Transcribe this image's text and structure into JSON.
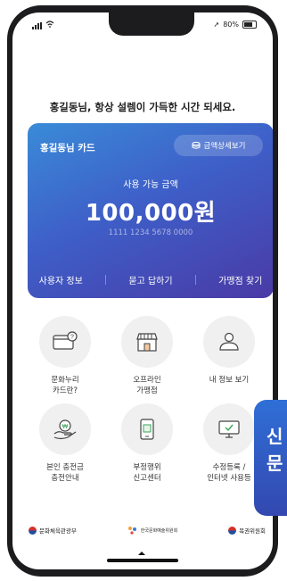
{
  "status": {
    "signal_icon": "signal-icon",
    "wifi_icon": "wifi-icon",
    "battery": "80%"
  },
  "greeting": "홍길동님, 항상 설렘이 가득한 시간 되세요.",
  "card": {
    "name": "홍길동님 카드",
    "balance_button": "금액상세보기",
    "available_label": "사용 가능 금액",
    "amount": "100,000원",
    "number": "1111 1234 5678 0000",
    "links": [
      "사용자 정보",
      "묻고 답하기",
      "가맹점 찾기"
    ]
  },
  "menu": [
    {
      "label": "문화누리\n카드란?",
      "icon": "card-question-icon"
    },
    {
      "label": "오프라인\n가맹점",
      "icon": "store-icon"
    },
    {
      "label": "내 정보 보기",
      "icon": "user-icon"
    },
    {
      "label": "본인 충전금\n충전안내",
      "icon": "charge-hand-icon"
    },
    {
      "label": "부정행위\n신고센터",
      "icon": "report-phone-icon"
    },
    {
      "label": "수정등록 /\n인터넷 사용등",
      "icon": "monitor-icon"
    }
  ],
  "logos": [
    "문화체육관광부",
    "한국문화예술위원회",
    "복권위원회"
  ],
  "float_panel_text": "신\n문"
}
